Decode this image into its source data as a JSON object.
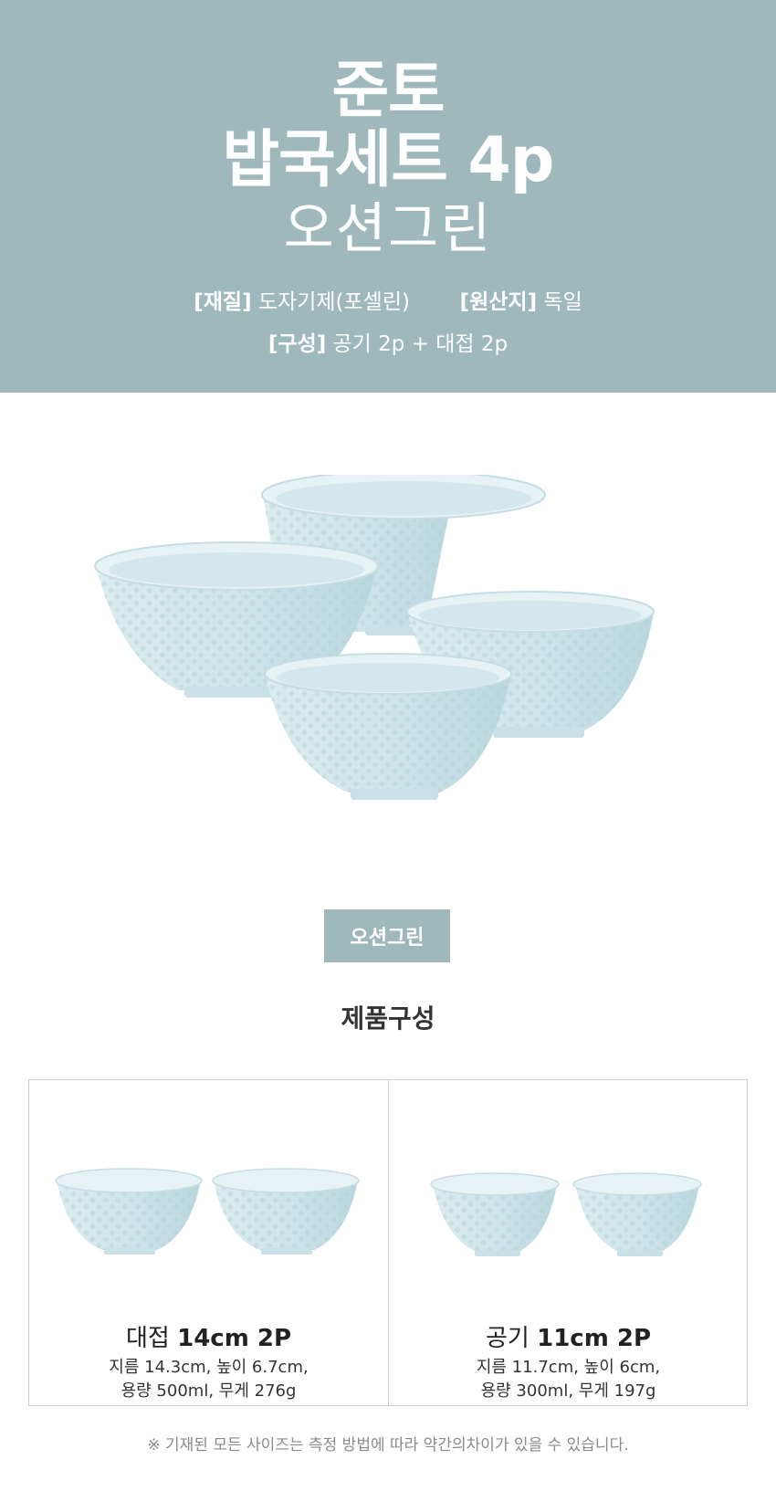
{
  "hero": {
    "title_line1": "준토",
    "title_line2": "밥국세트 4p",
    "color_name": "오션그린",
    "material_label": "[재질]",
    "material_value": "도자기제(포셀린)",
    "origin_label": "[원산지]",
    "origin_value": "독일",
    "composition_label": "[구성]",
    "composition_value": "공기 2p + 대접 2p",
    "accent_color": "#9fb8bc"
  },
  "color_badge": "오션그린",
  "section_title": "제품구성",
  "products": [
    {
      "name_prefix": "대접",
      "name_bold": "14cm 2P",
      "detail_line1": "지름 14.3cm, 높이 6.7cm,",
      "detail_line2": "용량 500ml, 무게 276g"
    },
    {
      "name_prefix": "공기",
      "name_bold": "11cm 2P",
      "detail_line1": "지름 11.7cm, 높이 6cm,",
      "detail_line2": "용량 300ml, 무게 197g"
    }
  ],
  "footnote": "※ 기재된 모든 사이즈는 측정 방법에 따라 약간의차이가 있을 수 있습니다.",
  "bowl_color": "#cfe5ea"
}
